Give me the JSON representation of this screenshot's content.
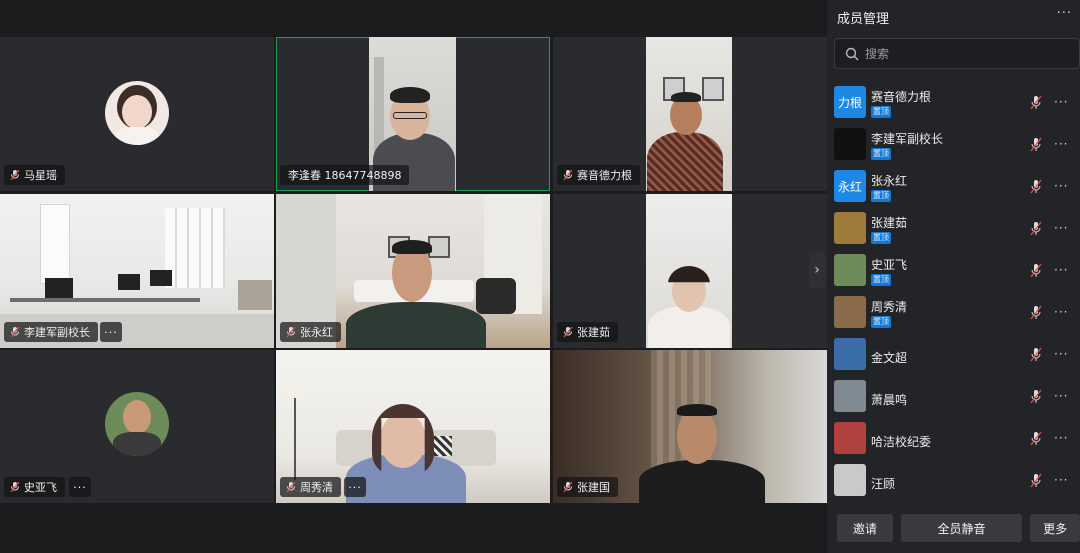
{
  "panel": {
    "title": "成员管理",
    "menu_icon": "more-horizontal-icon",
    "search_placeholder": "搜索",
    "footer": {
      "invite": "邀请",
      "mute_all": "全员静音",
      "more": "更多"
    }
  },
  "tiles": [
    {
      "name": "马星瑶",
      "type": "avatar"
    },
    {
      "name": "李逢春 18647748898",
      "type": "video",
      "active": true
    },
    {
      "name": "赛音德力根",
      "type": "video"
    },
    {
      "name": "李建军副校长",
      "type": "video",
      "more": "···"
    },
    {
      "name": "张永红",
      "type": "video"
    },
    {
      "name": "张建茹",
      "type": "video"
    },
    {
      "name": "史亚飞",
      "type": "avatar",
      "more": "···"
    },
    {
      "name": "周秀清",
      "type": "video",
      "more": "···"
    },
    {
      "name": "张建国",
      "type": "video"
    }
  ],
  "members": [
    {
      "name": "赛音德力根",
      "avatar_text": "力根",
      "avatar_color": "#1e88e5",
      "badge": "置顶"
    },
    {
      "name": "李建军副校长",
      "avatar_text": "",
      "avatar_color": "#111111",
      "badge": "置顶"
    },
    {
      "name": "张永红",
      "avatar_text": "永红",
      "avatar_color": "#1e88e5",
      "badge": "置顶"
    },
    {
      "name": "张建茹",
      "avatar_text": "",
      "avatar_color": "#a07a3a",
      "badge": "置顶"
    },
    {
      "name": "史亚飞",
      "avatar_text": "",
      "avatar_color": "#6e8b5a",
      "badge": "置顶"
    },
    {
      "name": "周秀清",
      "avatar_text": "",
      "avatar_color": "#8b6b4a",
      "badge": "置顶"
    },
    {
      "name": "金文超",
      "avatar_text": "",
      "avatar_color": "#3b6ea8",
      "badge": ""
    },
    {
      "name": "萧晨鸣",
      "avatar_text": "",
      "avatar_color": "#7f8a93",
      "badge": ""
    },
    {
      "name": "哈洁校纪委",
      "avatar_text": "",
      "avatar_color": "#b0413e",
      "badge": ""
    },
    {
      "name": "汪顾",
      "avatar_text": "",
      "avatar_color": "#c9c9c9",
      "badge": ""
    }
  ],
  "member_more": "···",
  "grid_next_arrow": "›",
  "colors": {
    "panel_bg": "#232427",
    "grid_bg": "#1b1c1e",
    "tile_bg": "#2a2b2e",
    "active_border": "#1f9d55",
    "badge_blue": "#1677d2"
  }
}
